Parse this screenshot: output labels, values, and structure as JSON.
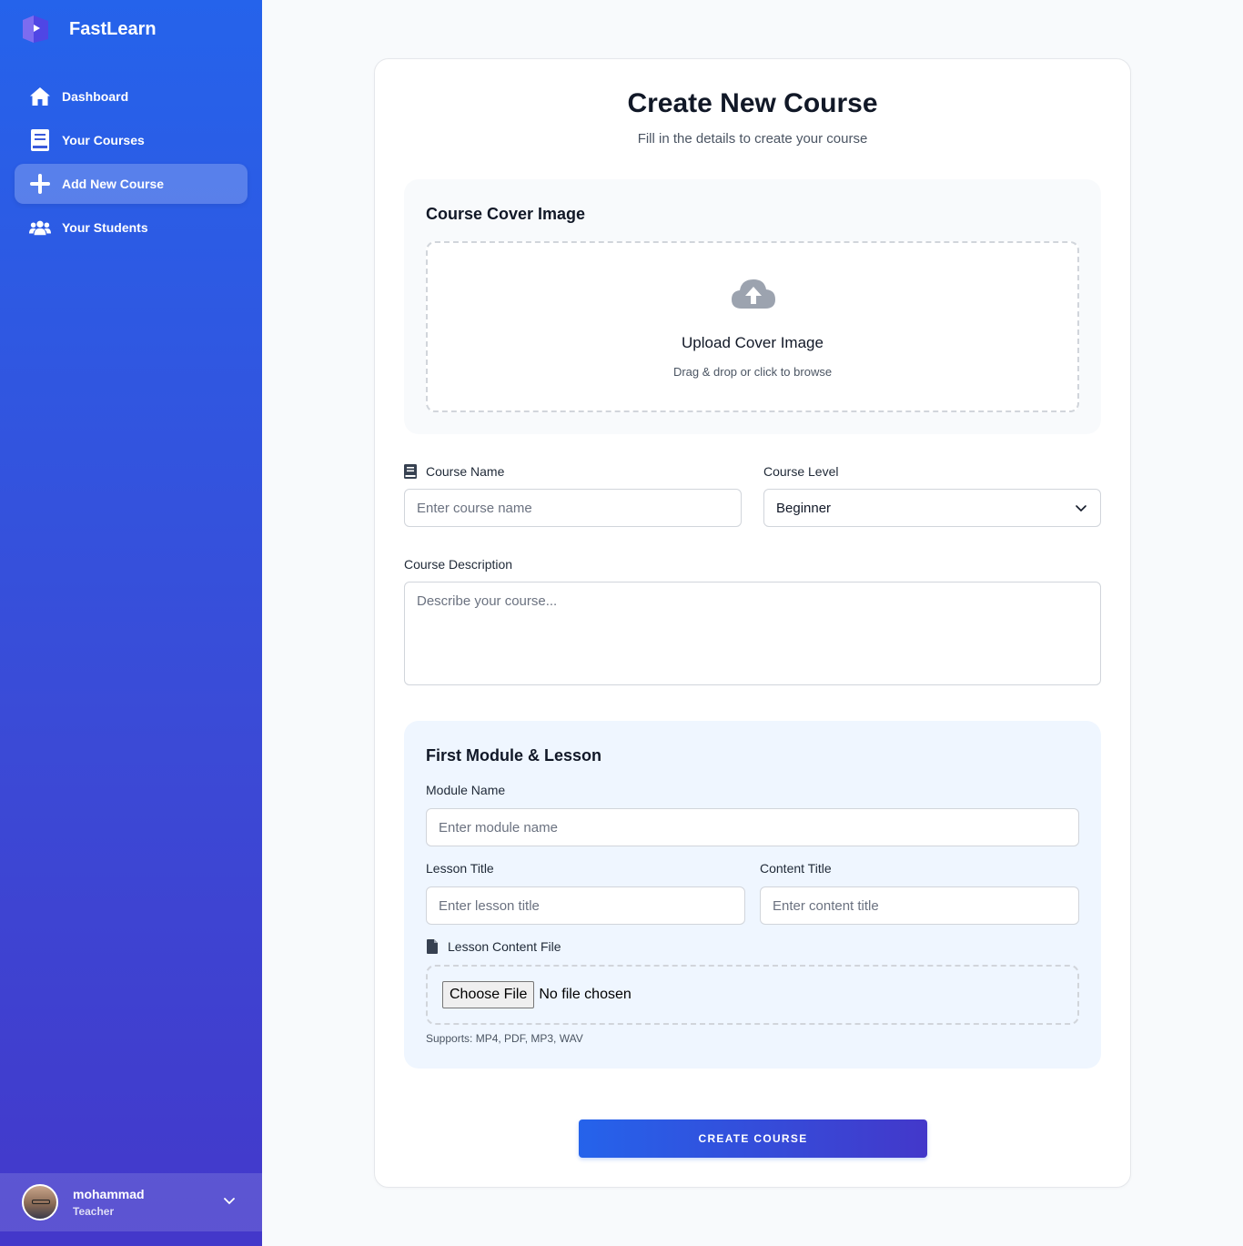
{
  "brand": {
    "name": "FastLearn",
    "icon": "fastlearn-logo"
  },
  "sidebar": {
    "items": [
      {
        "label": "Dashboard",
        "icon": "home-icon",
        "active": false
      },
      {
        "label": "Your Courses",
        "icon": "book-icon",
        "active": false
      },
      {
        "label": "Add New Course",
        "icon": "plus-icon",
        "active": true
      },
      {
        "label": "Your Students",
        "icon": "users-icon",
        "active": false
      }
    ]
  },
  "user": {
    "name": "mohammad",
    "role": "Teacher",
    "icon": "chevron-down-icon"
  },
  "form": {
    "title": "Create New Course",
    "subtitle": "Fill in the details to create your course",
    "cover": {
      "heading": "Course Cover Image",
      "upload_title": "Upload Cover Image",
      "upload_hint": "Drag & drop or click to browse",
      "icon": "cloud-upload-icon"
    },
    "course_name": {
      "label": "Course Name",
      "placeholder": "Enter course name",
      "value": "",
      "icon": "book-icon"
    },
    "course_level": {
      "label": "Course Level",
      "value": "Beginner"
    },
    "description": {
      "label": "Course Description",
      "placeholder": "Describe your course...",
      "value": ""
    },
    "module": {
      "heading": "First Module & Lesson",
      "module_name": {
        "label": "Module Name",
        "placeholder": "Enter module name",
        "value": ""
      },
      "lesson_title": {
        "label": "Lesson Title",
        "placeholder": "Enter lesson title",
        "value": ""
      },
      "content_title": {
        "label": "Content Title",
        "placeholder": "Enter content title",
        "value": ""
      },
      "content_file": {
        "label": "Lesson Content File",
        "button": "Choose File",
        "status": "No file chosen",
        "supports": "Supports: MP4, PDF, MP3, WAV",
        "icon": "file-icon"
      }
    },
    "submit_label": "CREATE COURSE"
  },
  "colors": {
    "accent": "#2563eb",
    "accent_end": "#4338ca",
    "panel_blue": "#eff6ff",
    "panel_gray": "#f8fafc"
  }
}
